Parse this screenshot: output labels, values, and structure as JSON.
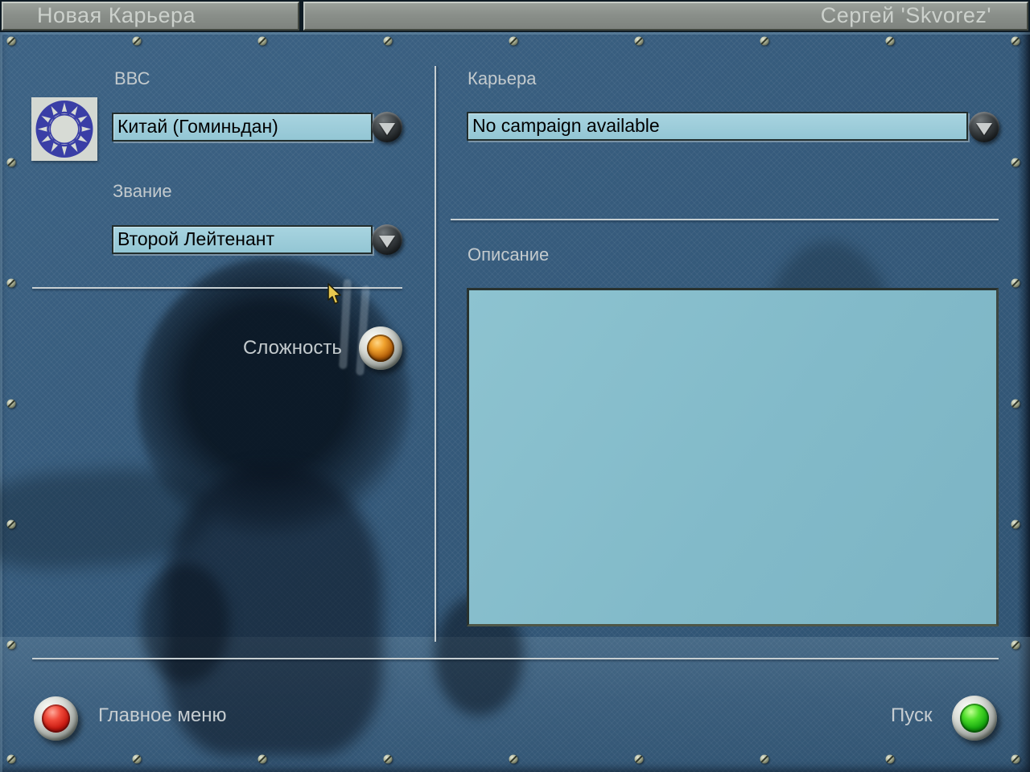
{
  "window": {
    "title_tab": "Новая Карьера",
    "pilot_tab": "Сергей 'Skvorez'"
  },
  "airforce": {
    "label": "ВВС",
    "selected": "Китай (Гоминьдан)",
    "flag_icon": "kuomintang-sun-emblem"
  },
  "rank": {
    "label": "Звание",
    "selected": "Второй Лейтенант"
  },
  "difficulty": {
    "label": "Сложность",
    "button_icon": "amber-round-button"
  },
  "career": {
    "label": "Карьера",
    "selected": "No campaign available"
  },
  "description": {
    "label": "Описание",
    "text": ""
  },
  "footer": {
    "main_menu_label": "Главное меню",
    "main_menu_icon": "red-round-button",
    "start_label": "Пуск",
    "start_icon": "green-round-button"
  },
  "icons": {
    "dropdown_arrow": "down-triangle"
  },
  "colors": {
    "panel_blue": "#355a7b",
    "field_blue": "#99c9d6",
    "description_blue": "#82bac9",
    "tab_gray": "#8a8f8a",
    "label_gray": "#c3cacd",
    "accent_red": "#cb1b12",
    "accent_green": "#18ab10",
    "accent_amber": "#f0a22e",
    "flag_blue": "#3a3ea6"
  }
}
